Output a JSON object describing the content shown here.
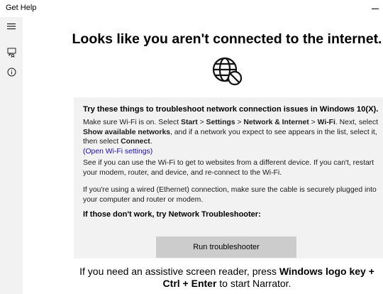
{
  "window": {
    "title": "Get Help"
  },
  "sidebar": {
    "items": [
      {
        "icon": "hamburger-menu-icon"
      },
      {
        "icon": "feedback-icon"
      },
      {
        "icon": "info-icon"
      }
    ]
  },
  "main": {
    "headline": "Looks like you aren't connected to the internet.",
    "icon": "globe-no-connection-icon",
    "panel": {
      "title": "Try these things to troubleshoot network connection issues in Windows 10(X).",
      "wifi": {
        "t1": "Make sure Wi-Fi is on. Select ",
        "start": "Start",
        "sep": " > ",
        "settings": "Settings",
        "network": "Network & Internet",
        "wifi": "Wi-Fi",
        "t2": ". Next, select ",
        "show": "Show available networks",
        "t3": ", and if a network you expect to see appears in the list, select it, then select ",
        "connect": "Connect",
        "t4": ".",
        "link": "(Open Wi-Fi settings)"
      },
      "para2": "See if you can use the Wi-Fi to get to websites from a different device. If you can't, restart your modem, router, and device, and re-connect to the Wi-Fi.",
      "para3": "If you're using a wired (Ethernet) connection, make sure the cable is securely plugged into your computer and router or modem.",
      "subheading": "If those don't work, try Network Troubleshooter:",
      "button_label": "Run troubleshooter"
    },
    "narrator": {
      "t1": "If you need an assistive screen reader, press ",
      "keys": "Windows logo key + Ctrl + Enter",
      "t2": " to start Narrator."
    }
  }
}
